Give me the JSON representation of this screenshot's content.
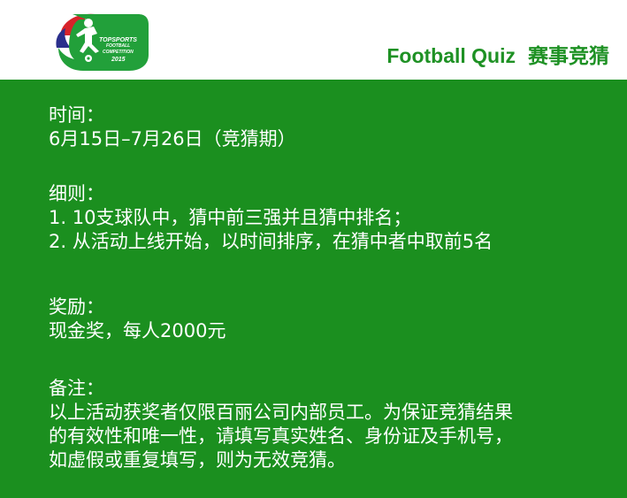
{
  "header": {
    "logo": {
      "line1": "TOPSPORTS",
      "line2": "FOOTBALL",
      "line3": "COMPETITION",
      "line4": "2015"
    },
    "title_en": "Football Quiz",
    "title_cn": "赛事竞猜"
  },
  "sections": {
    "time": {
      "heading": "时间：",
      "lines": [
        "6月15日–7月26日（竞猜期）"
      ]
    },
    "rules": {
      "heading": "细则：",
      "lines": [
        "1.  10支球队中，猜中前三强并且猜中排名；",
        "2.  从活动上线开始，以时间排序，在猜中者中取前5名"
      ]
    },
    "reward": {
      "heading": "奖励：",
      "lines": [
        "现金奖，每人2000元"
      ]
    },
    "note": {
      "heading": "备注：",
      "lines": [
        "以上活动获奖者仅限百丽公司内部员工。为保证竞猜结果",
        "的有效性和唯一性，请填写真实姓名、身份证及手机号，",
        "如虚假或重复填写，则为无效竞猜。"
      ]
    }
  },
  "colors": {
    "green_bg": "#1b8f1f",
    "title_green": "#1e9124",
    "logo_red": "#d8232a",
    "logo_blue": "#2a2f8c",
    "logo_green": "#22a03a"
  },
  "icons": {
    "logo": "football-player-logo-icon"
  }
}
